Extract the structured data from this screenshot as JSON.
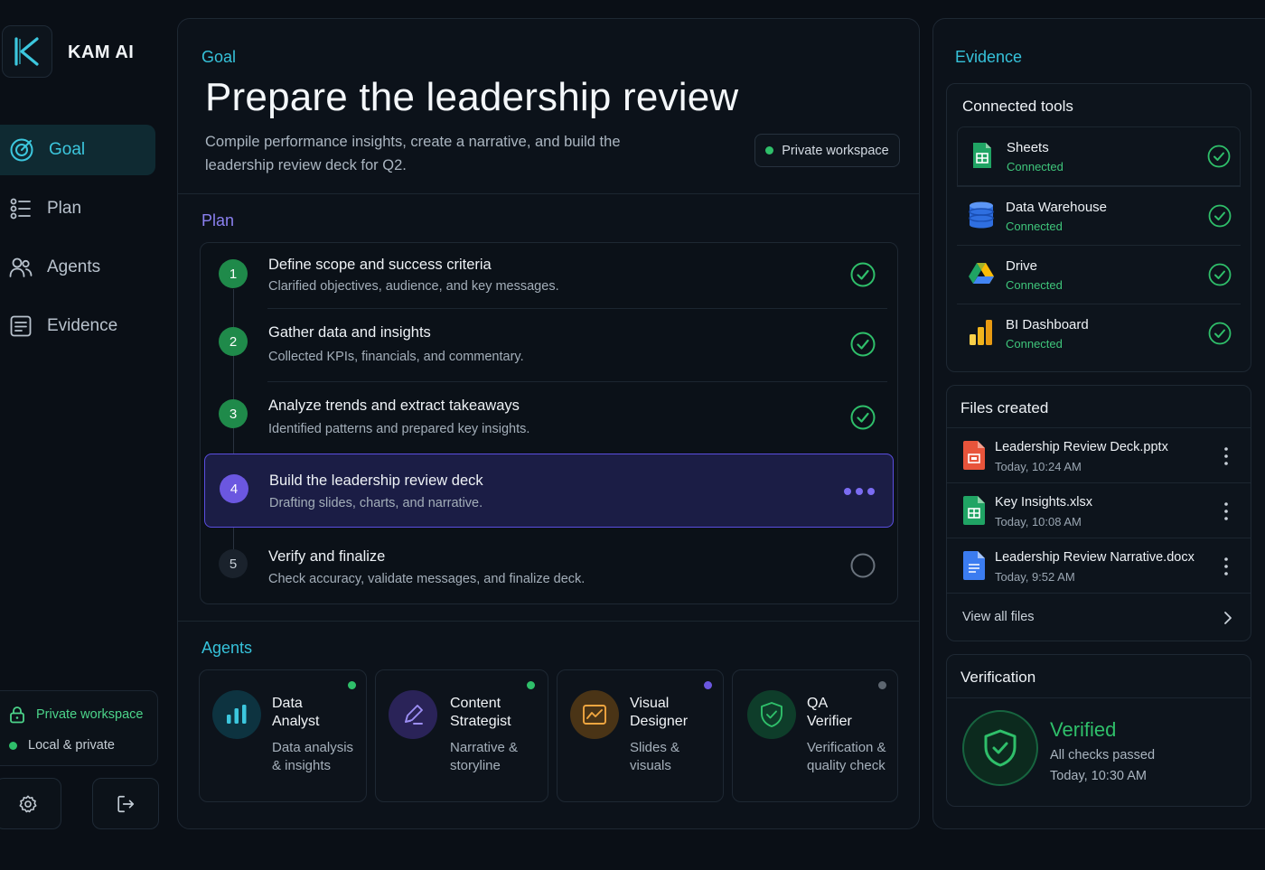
{
  "app": {
    "name": "KAM AI"
  },
  "sidebar": {
    "items": [
      {
        "label": "Goal",
        "icon": "target-icon",
        "active": true
      },
      {
        "label": "Plan",
        "icon": "list-icon",
        "active": false
      },
      {
        "label": "Agents",
        "icon": "users-icon",
        "active": false
      },
      {
        "label": "Evidence",
        "icon": "document-icon",
        "active": false
      }
    ],
    "workspace": {
      "title": "Private workspace",
      "status": "Local & private"
    }
  },
  "goal": {
    "section_label": "Goal",
    "title": "Prepare the leadership review",
    "description": "Compile performance insights, create a narrative, and build the leadership review deck for Q2.",
    "badge": "Private workspace"
  },
  "plan": {
    "section_label": "Plan",
    "steps": [
      {
        "number": "1",
        "title": "Define scope and success criteria",
        "subtitle": "Clarified objectives, audience, and key messages.",
        "status": "done"
      },
      {
        "number": "2",
        "title": "Gather data and insights",
        "subtitle": "Collected KPIs, financials, and commentary.",
        "status": "done"
      },
      {
        "number": "3",
        "title": "Analyze trends and extract takeaways",
        "subtitle": "Identified patterns and prepared key insights.",
        "status": "done"
      },
      {
        "number": "4",
        "title": "Build the leadership review deck",
        "subtitle": "Drafting slides, charts, and narrative.",
        "status": "in-progress"
      },
      {
        "number": "5",
        "title": "Verify and finalize",
        "subtitle": "Check accuracy, validate messages, and finalize deck.",
        "status": "pending"
      }
    ]
  },
  "agents": {
    "section_label": "Agents",
    "items": [
      {
        "name_line1": "Data",
        "name_line2": "Analyst",
        "desc_line1": "Data analysis",
        "desc_line2": "& insights",
        "status_color": "#2fbf6a",
        "icon": "bar-chart-icon"
      },
      {
        "name_line1": "Content",
        "name_line2": "Strategist",
        "desc_line1": "Narrative &",
        "desc_line2": "storyline",
        "status_color": "#2fbf6a",
        "icon": "pen-icon"
      },
      {
        "name_line1": "Visual",
        "name_line2": "Designer",
        "desc_line1": "Slides &",
        "desc_line2": "visuals",
        "status_color": "#6b57e0",
        "icon": "image-chart-icon"
      },
      {
        "name_line1": "QA",
        "name_line2": "Verifier",
        "desc_line1": "Verification &",
        "desc_line2": "quality check",
        "status_color": "#5d6670",
        "icon": "shield-check-icon"
      }
    ]
  },
  "evidence": {
    "section_label": "Evidence",
    "tools_title": "Connected tools",
    "tools": [
      {
        "name": "Sheets",
        "status": "Connected",
        "icon": "sheets-icon"
      },
      {
        "name": "Data Warehouse",
        "status": "Connected",
        "icon": "database-icon"
      },
      {
        "name": "Drive",
        "status": "Connected",
        "icon": "drive-icon"
      },
      {
        "name": "BI Dashboard",
        "status": "Connected",
        "icon": "bi-dashboard-icon"
      }
    ],
    "files_title": "Files created",
    "files": [
      {
        "name": "Leadership Review Deck.pptx",
        "time": "Today, 10:24 AM",
        "icon": "slides-file-icon",
        "color": "#e8543b"
      },
      {
        "name": "Key Insights.xlsx",
        "time": "Today, 10:08 AM",
        "icon": "sheet-file-icon",
        "color": "#20a464"
      },
      {
        "name": "Leadership Review Narrative.docx",
        "time": "Today, 9:52 AM",
        "icon": "doc-file-icon",
        "color": "#3b7cf0"
      }
    ],
    "view_all": "View all files",
    "verification": {
      "title": "Verification",
      "status": "Verified",
      "detail": "All checks passed",
      "time": "Today, 10:30 AM"
    }
  },
  "colors": {
    "accent": "#36c2da",
    "success": "#2fbf6a",
    "progress": "#6b57e0"
  }
}
